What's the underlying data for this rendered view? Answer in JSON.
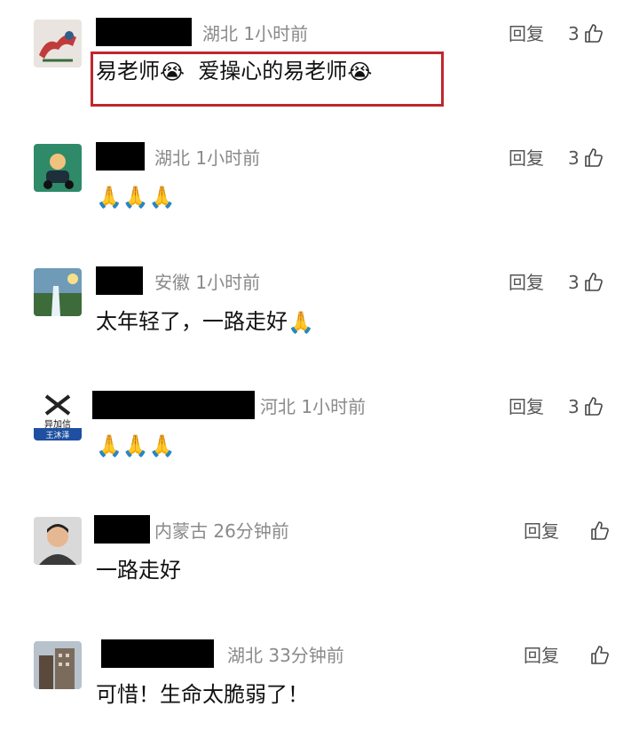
{
  "comments": [
    {
      "meta": "湖北 1小时前",
      "reply": "回复",
      "likes": "3",
      "text_parts": [
        "易老师",
        "爱操心的易老师"
      ],
      "avatar": "dragon-avatar"
    },
    {
      "meta": "湖北 1小时前",
      "reply": "回复",
      "likes": "3",
      "text": "🙏🙏🙏",
      "avatar": "cartoon-rider-avatar"
    },
    {
      "meta": "安徽 1小时前",
      "reply": "回复",
      "likes": "3",
      "text": "太年轻了，一路走好",
      "avatar": "waterfall-avatar"
    },
    {
      "meta": "河北 1小时前",
      "reply": "回复",
      "likes": "3",
      "text": "🙏🙏🙏",
      "avatar_text": "异加信",
      "avatar_sub": "王沐泽"
    },
    {
      "meta": "内蒙古 26分钟前",
      "reply": "回复",
      "likes": "",
      "text": "一路走好",
      "avatar": "man-photo-avatar"
    },
    {
      "meta": "湖北 33分钟前",
      "reply": "回复",
      "likes": "",
      "text": "可惜！生命太脆弱了！",
      "avatar": "building-avatar"
    }
  ],
  "colors": {
    "highlight": "#c0272d",
    "meta": "#8a8a8a"
  }
}
